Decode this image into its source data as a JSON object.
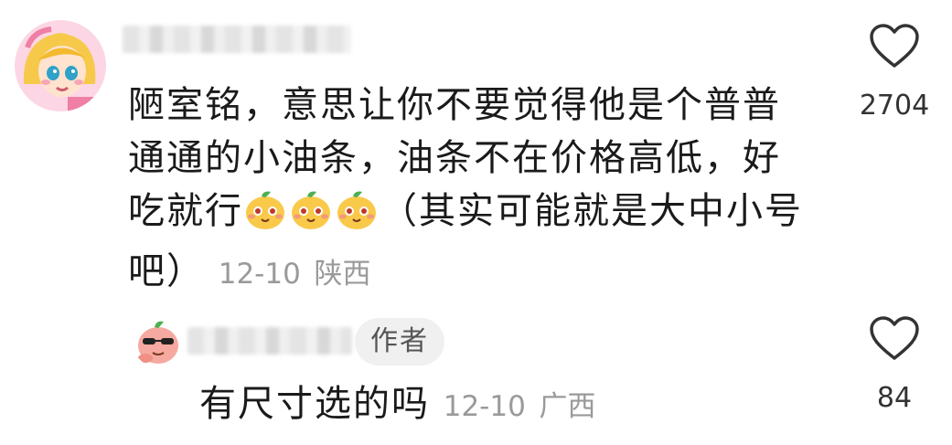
{
  "comment": {
    "line1": "陋室铭，意思让你不要觉得他是个普普",
    "line2": "通通的小油条，油条不在价格高低，好",
    "line3_start": "吃就行",
    "line3_end": "（其实可能就是大中小号",
    "line4": "吧）",
    "date": "12-10",
    "location": "陕西",
    "likes": "2704",
    "emoji_icon": "bun-face-emoji",
    "emoji_count": 3
  },
  "reply": {
    "badge": "作者",
    "text": "有尺寸选的吗",
    "date": "12-10",
    "location": "广西",
    "likes": "84"
  },
  "colors": {
    "text": "#1a1a1a",
    "meta": "#9a9a9a",
    "badge_bg": "#f0f0f0"
  }
}
